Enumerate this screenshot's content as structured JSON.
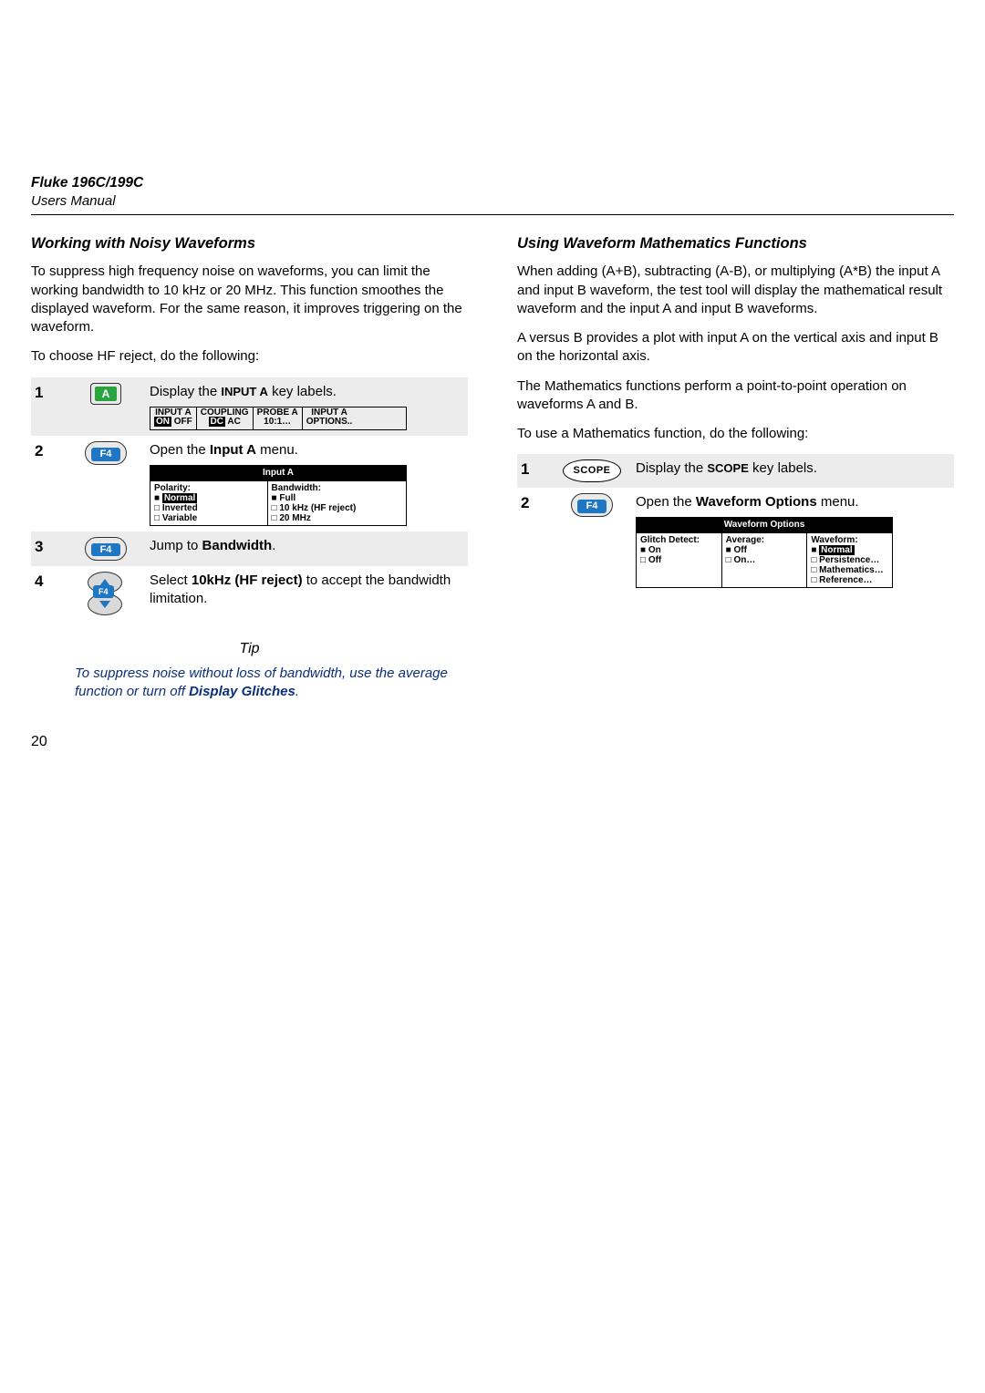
{
  "header": {
    "model": "Fluke 196C/199C",
    "manual": "Users Manual"
  },
  "left": {
    "title": "Working with Noisy Waveforms",
    "p1": "To suppress high frequency noise on waveforms, you can limit the working bandwidth to 10 kHz or 20 MHz. This function smoothes the displayed waveform. For the same reason, it improves triggering on the waveform.",
    "p2": "To choose HF reject, do the following:",
    "steps": {
      "s1": {
        "num": "1",
        "key": "A",
        "desc_pre": "Display the ",
        "desc_sc": "input a",
        "desc_post": " key labels.",
        "bar": {
          "c1a": "INPUT A",
          "c1b_on": "ON",
          "c1b_off": "  OFF",
          "c2a": "COUPLING",
          "c2b_dc": "DC",
          "c2b_ac": "    AC",
          "c3a": "PROBE A",
          "c3b": "10:1…",
          "c4a": "INPUT A",
          "c4b": "OPTIONS.."
        }
      },
      "s2": {
        "num": "2",
        "key": "F4",
        "desc_pre": "Open the ",
        "desc_bold": "Input A",
        "desc_post": " menu.",
        "panel": {
          "title": "Input A",
          "l_title": "Polarity:",
          "l1": "Normal",
          "l2": "Inverted",
          "l3": "Variable",
          "r_title": "Bandwidth:",
          "r1": "Full",
          "r2": "10 kHz (HF reject)",
          "r3": "20 MHz"
        }
      },
      "s3": {
        "num": "3",
        "key": "F4",
        "desc_pre": "Jump to ",
        "desc_bold": "Bandwidth",
        "desc_post": "."
      },
      "s4": {
        "num": "4",
        "key": "F4",
        "desc_pre": "Select ",
        "desc_bold": "10kHz (HF reject)",
        "desc_post": " to accept the bandwidth limitation."
      }
    },
    "tip_label": "Tip",
    "tip_body_pre": "To suppress noise without loss of bandwidth, use the average function or turn off ",
    "tip_bold": "Display Glitches",
    "tip_body_post": "."
  },
  "right": {
    "title": "Using Waveform Mathematics Functions",
    "p1": "When adding (A+B), subtracting (A-B), or multiplying (A*B) the input A and input B waveform, the test tool will display the mathematical result waveform and the input A and input B waveforms.",
    "p2": "A versus B provides a plot with input A on the vertical axis and input B on the horizontal axis.",
    "p3": "The Mathematics functions perform a point-to-point operation on waveforms A and B.",
    "p4": "To use a Mathematics function, do the following:",
    "steps": {
      "s1": {
        "num": "1",
        "key": "SCOPE",
        "desc_pre": "Display the ",
        "desc_sc": "scope",
        "desc_post": " key labels."
      },
      "s2": {
        "num": "2",
        "key": "F4",
        "desc_pre": "Open the ",
        "desc_bold": "Waveform Options",
        "desc_post": " menu.",
        "panel": {
          "title": "Waveform Options",
          "c1_t": "Glitch Detect:",
          "c1_1": "On",
          "c1_2": "Off",
          "c2_t": "Average:",
          "c2_1": "Off",
          "c2_2": "On…",
          "c3_t": "Waveform:",
          "c3_1": "Normal",
          "c3_2": "Persistence…",
          "c3_3": "Mathematics…",
          "c3_4": "Reference…"
        }
      }
    }
  },
  "pageNum": "20"
}
